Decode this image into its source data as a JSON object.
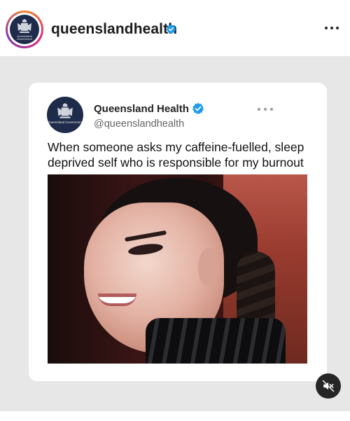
{
  "header": {
    "username": "queenslandhealth",
    "avatar_caption": "Queensland Government",
    "more_icon": "more-horizontal-icon",
    "verified_icon": "verified-badge-icon"
  },
  "tweet": {
    "display_name": "Queensland Health",
    "handle": "@queenslandhealth",
    "text": "When someone asks my caffeine-fuelled, sleep deprived self who is responsible for my burnout",
    "avatar_caption": "Queensland Government",
    "more_icon": "more-horizontal-icon",
    "verified_icon": "verified-badge-icon"
  },
  "media": {
    "mute_icon": "muted-speaker-icon"
  },
  "colors": {
    "verified_blue": "#1d9bf0",
    "header_bg": "#ffffff",
    "content_bg": "#e7e7e7",
    "avatar_bg": "#1f2b4a"
  }
}
